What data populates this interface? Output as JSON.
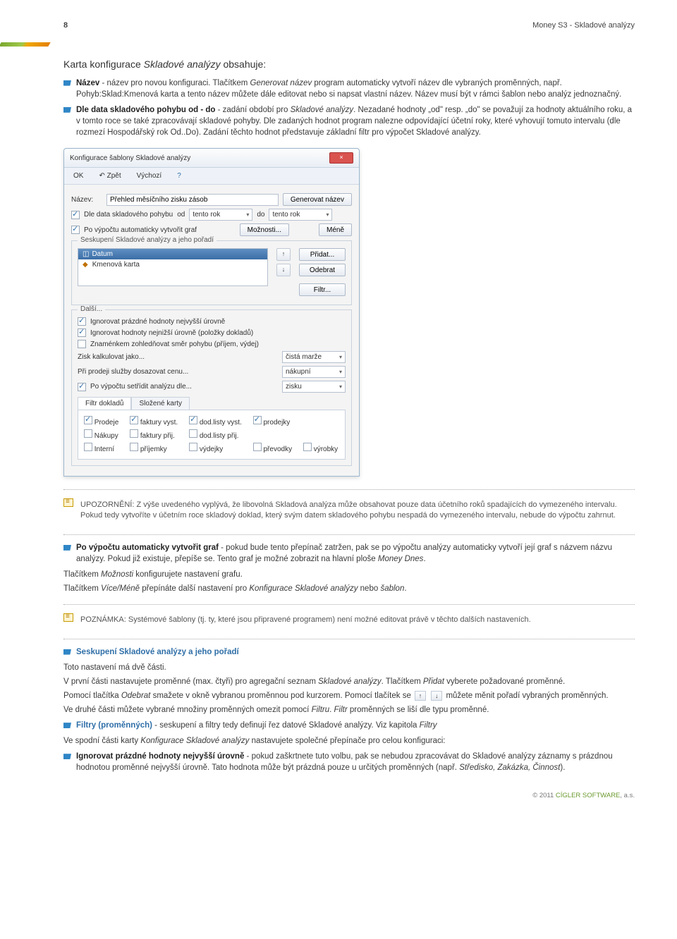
{
  "header": {
    "page_num": "8",
    "doc_title": "Money S3 - Skladové analýzy"
  },
  "intro": {
    "title_pre": "Karta konfigurace",
    "title_it": "Skladové analýzy",
    "title_post": "obsahuje:"
  },
  "b1": {
    "lead": "Název",
    "t1": " - název pro novou konfiguraci. Tlačítkem ",
    "it1": "Generovat název",
    "t2": " program automaticky vytvoří název dle vybraných proměnných, např. Pohyb:Sklad:Kmenová karta a tento název můžete dále editovat nebo si napsat vlastní název. Název musí být v rámci šablon nebo analýz jednoznačný."
  },
  "b2": {
    "lead": "Dle data skladového pohybu od - do",
    "t1": " - zadání období pro ",
    "it1": "Skladové analýzy",
    "t2": ". Nezadané hodnoty „od\" resp. „do\" se považují za hodnoty aktuálního roku, a v tomto roce se také zpracovávají skladové pohyby. Dle zadaných hodnot program nalezne odpovídající účetní roky, které vyhovují tomuto intervalu (dle rozmezí Hospodářský rok Od..Do). Zadání těchto hodnot představuje základní filtr pro výpočet Skladové analýzy."
  },
  "dlg": {
    "title": "Konfigurace šablony Skladové analýzy",
    "toolbar": {
      "ok": "OK",
      "back": "Zpět",
      "default": "Výchozí"
    },
    "name_label": "Název:",
    "name_value": "Přehled měsíčního zisku zásob",
    "gen_btn": "Generovat název",
    "chk_date": "Dle data skladového pohybu",
    "od": "od",
    "do": "do",
    "range1": "tento rok",
    "range2": "tento rok",
    "chk_graph": "Po výpočtu automaticky vytvořit graf",
    "opt_btn": "Možnosti...",
    "less_btn": "Méně",
    "group_legend": "Seskupení Skladové analýzy a jeho pořadí",
    "list_hdr": "Datum",
    "list_item": "Kmenová karta",
    "btn_add": "Přidat...",
    "btn_remove": "Odebrat",
    "btn_filter": "Filtr...",
    "group2_legend": "Další...",
    "chk_ig1": "Ignorovat prázdné hodnoty nejvyšší úrovně",
    "chk_ig2": "Ignorovat hodnoty nejnižší úrovně (položky dokladů)",
    "chk_sign": "Znaménkem zohledňovat směr pohybu (příjem, výdej)",
    "row_zisk_l": "Zisk kalkulovat jako...",
    "row_zisk_v": "čistá marže",
    "row_prodej_l": "Při prodeji služby dosazovat cenu...",
    "row_prodej_v": "nákupní",
    "chk_sort": "Po výpočtu setřídit analýzu dle...",
    "sort_v": "zisku",
    "tab1": "Filtr dokladů",
    "tab2": "Složené karty",
    "c_prodeje": "Prodeje",
    "c_nakupy": "Nákupy",
    "c_interni": "Interní",
    "c_fv": "faktury vyst.",
    "c_fp": "faktury přij.",
    "c_pr": "příjemky",
    "c_dlv": "dod.listy vyst.",
    "c_dlp": "dod.listy přij.",
    "c_vy": "výdejky",
    "c_pj": "prodejky",
    "c_prv": "převodky",
    "c_vyr": "výrobky",
    "close": "×"
  },
  "upo": {
    "label": "UPOZORNĚNÍ:",
    "text": " Z výše uvedeného vyplývá, že libovolná Skladová analýza může obsahovat pouze data účetního roků spadajících do vymezeného intervalu. Pokud tedy vytvoříte v účetním roce skladový doklad, který svým datem skladového pohybu nespadá do vymezeného intervalu, nebude do výpočtu zahrnut."
  },
  "b3": {
    "lead": "Po výpočtu automaticky vytvořit graf",
    "t1": " - pokud bude tento přepínač zatržen, pak se po výpočtu analýzy automaticky vytvoří její graf s názvem názvu analýzy. Pokud již existuje, přepíše se. Tento graf je možné zobrazit na hlavní ploše ",
    "it1": "Money Dnes",
    "t2": "."
  },
  "p_opts": {
    "t1": "Tlačítkem ",
    "it1": "Možnosti",
    "t2": " konfigurujete nastavení grafu."
  },
  "p_more": {
    "t1": "Tlačítkem ",
    "it1": "Více/Méně",
    "t2": " přepínáte další nastavení pro ",
    "it2": "Konfigurace Skladové analýzy",
    "t3": " nebo ",
    "it3": "šablon",
    "t4": "."
  },
  "pozn": {
    "label": "POZNÁMKA:",
    "text": " Systémové šablony (tj. ty, které jsou připravené programem) není možné editovat právě v těchto dalších nastaveních."
  },
  "b4": {
    "lead": "Seskupení Skladové analýzy a jeho pořadí"
  },
  "p_two": "Toto nastavení má dvě části.",
  "p_first": {
    "t1": "V první části nastavujete proměnné (max. čtyři) pro agregační seznam ",
    "it1": "Skladové analýzy",
    "t2": ". Tlačítkem ",
    "it2": "Přidat",
    "t3": " vyberete požadované proměnné."
  },
  "p_odebrat": {
    "t1": "Pomocí tlačítka ",
    "it1": "Odebrat",
    "t2": " smažete v okně vybranou proměnnou pod kurzorem. Pomocí tlačítek se ",
    "t3": " můžete měnit pořadí vybraných proměnných."
  },
  "p_second": {
    "t1": "Ve druhé části můžete vybrané množiny proměnných omezit pomocí ",
    "it1": "Filtru",
    "t2": ". ",
    "it2": "Filtr",
    "t3": " proměnných se liší dle typu proměnné."
  },
  "b5": {
    "lead": "Filtry (proměnných)",
    "t1": "  - seskupení a filtry tedy definují řez datové Skladové analýzy. Viz kapitola ",
    "it1": "Filtry"
  },
  "p_bottom": {
    "t1": "Ve spodní části karty ",
    "it1": "Konfigurace Skladové analýzy",
    "t2": " nastavujete společné přepínače pro celou konfiguraci:"
  },
  "b6": {
    "lead": "Ignorovat prázdné hodnoty nejvyšší úrovně",
    "t1": " - pokud zaškrtnete tuto volbu, pak se nebudou zpracovávat do Skladové analýzy záznamy s prázdnou hodnotou proměnné nejvyšší úrovně. Tato hodnota může být prázdná pouze u určitých proměnných (např. ",
    "it1": "Středisko, Zakázka, Činnost",
    "t2": ")."
  },
  "footer": {
    "copy": "© 2011",
    "vendor": "CÍGLER SOFTWARE",
    "suffix": ", a.s."
  }
}
